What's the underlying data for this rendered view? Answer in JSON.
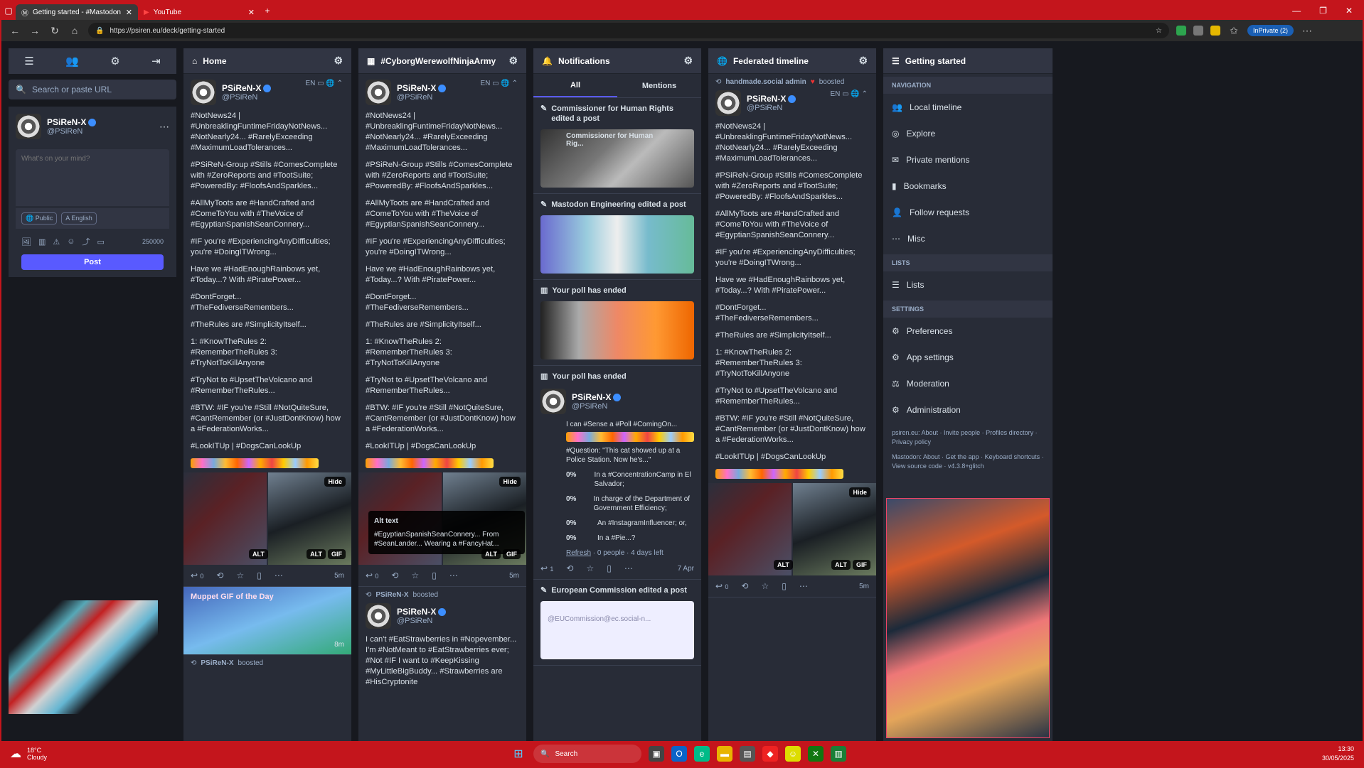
{
  "browser": {
    "tabs": [
      {
        "label": "Getting started - #Mastodon",
        "active": true
      },
      {
        "label": "YouTube",
        "active": false
      }
    ],
    "url": "https://psiren.eu/deck/getting-started",
    "inprivate": "InPrivate (2)"
  },
  "left": {
    "search_placeholder": "Search or paste URL",
    "profile": {
      "name": "PSiReN-X",
      "handle": "@PSiReN"
    },
    "compose_placeholder": "What's on your mind?",
    "visibility": "Public",
    "language": "English",
    "char_count": "250000",
    "post_label": "Post"
  },
  "columns": {
    "home": {
      "title": "Home"
    },
    "hashtag": {
      "title": "#CyborgWerewolfNinjaArmy"
    },
    "notifications": {
      "title": "Notifications",
      "tab_all": "All",
      "tab_mentions": "Mentions"
    },
    "federated": {
      "title": "Federated timeline"
    },
    "getting_started": {
      "title": "Getting started"
    }
  },
  "post": {
    "name": "PSiReN-X",
    "handle": "@PSiReN",
    "lang": "EN",
    "paragraphs": [
      "#NotNews24 | #UnbreaklingFuntimeFridayNotNews... #NotNearly24... #RarelyExceeding #MaximumLoadTolerances...",
      "#PSiReN-Group #Stills #ComesComplete with #ZeroReports and #TootSuite; #PoweredBy: #FloofsAndSparkles...",
      "#AllMyToots are #HandCrafted and #ComeToYou with #TheVoice of #EgyptianSpanishSeanConnery...",
      "#IF you're #ExperiencingAnyDifficulties; you're #DoingITWrong...",
      "Have we #HadEnoughRainbows yet, #Today...? With #PiratePower...",
      "#DontForget... #TheFediverseRemembers...",
      "#TheRules are #SimplicityItself...",
      "1: #KnowTheRules 2: #RememberTheRules 3: #TryNotToKillAnyone",
      "#TryNot to #UpsetTheVolcano and #RememberTheRules...",
      "#BTW: #IF you're #Still #NotQuiteSure, #CantRemember (or #JustDontKnow) how a #FederationWorks...",
      "#LookITUp | #DogsCanLookUp"
    ],
    "hide": "Hide",
    "alt": "ALT",
    "gif": "GIF",
    "replies": "0",
    "time": "5m"
  },
  "home_extra": {
    "gif_title": "Muppet GIF of the Day",
    "gif_time": "8m",
    "boosted_by": "PSiReN-X",
    "boosted_label": "boosted"
  },
  "hashtag_extra": {
    "alt_title": "Alt text",
    "alt_body": "#EgyptianSpanishSeanConnery... From #SeanLander... Wearing a #FancyHat...",
    "boosted_by": "PSiReN-X",
    "boosted_label": "boosted",
    "second_post": "I can't #EatStrawberries in #Nopevember... I'm #NotMeant to #EatStrawberries ever; #Not #IF I want to #KeepKissing #MyLittleBigBuddy... #Strawberries are #HisCryptonite"
  },
  "notifications": {
    "n1": "Commissioner for Human Rights edited a post",
    "n1_card": "Commissioner for Human Rig...",
    "n2": "Mastodon Engineering edited a post",
    "n3": "Your poll has ended",
    "n4": "Your poll has ended",
    "poll_name": "PSiReN-X",
    "poll_handle": "@PSiReN",
    "poll_q1": "I can #Sense a #Poll #ComingOn...",
    "poll_q2": "#Question: \"This cat showed up at a Police Station. Now he's...\"",
    "options": [
      {
        "pct": "0%",
        "text": "In a #ConcentrationCamp in El Salvador;"
      },
      {
        "pct": "0%",
        "text": "In charge of the Department of Government Efficiency;"
      },
      {
        "pct": "0%",
        "text": "An #InstagramInfluencer; or,"
      },
      {
        "pct": "0%",
        "text": "In a #Pie...?"
      }
    ],
    "refresh": "Refresh",
    "poll_footer": "· 0 people · 4 days left",
    "reply_count": "1",
    "date": "7 Apr",
    "n5": "European Commission edited a post",
    "n5_card": "@EUCommission@ec.social-n..."
  },
  "federated": {
    "boost_by": "handmade.social admin",
    "boost_label": "boosted",
    "time": "5m"
  },
  "getting_started": {
    "navigation": "NAVIGATION",
    "nav_items": [
      "Local timeline",
      "Explore",
      "Private mentions",
      "Bookmarks",
      "Follow requests",
      "Misc"
    ],
    "lists_label": "LISTS",
    "lists": "Lists",
    "settings_label": "SETTINGS",
    "settings_items": [
      "Preferences",
      "App settings",
      "Moderation",
      "Administration"
    ],
    "footer1": "psiren.eu: About · Invite people · Profiles directory · Privacy policy",
    "footer2": "Mastodon: About · Get the app · Keyboard shortcuts · View source code · v4.3.8+glitch"
  },
  "taskbar": {
    "temp": "18°C",
    "weather": "Cloudy",
    "search": "Search",
    "time": "13:30",
    "date": "30/05/2025"
  },
  "colors": {
    "accent": "#595aff",
    "browser_frame": "#c4151c",
    "hashtag": "#8c8dff"
  }
}
